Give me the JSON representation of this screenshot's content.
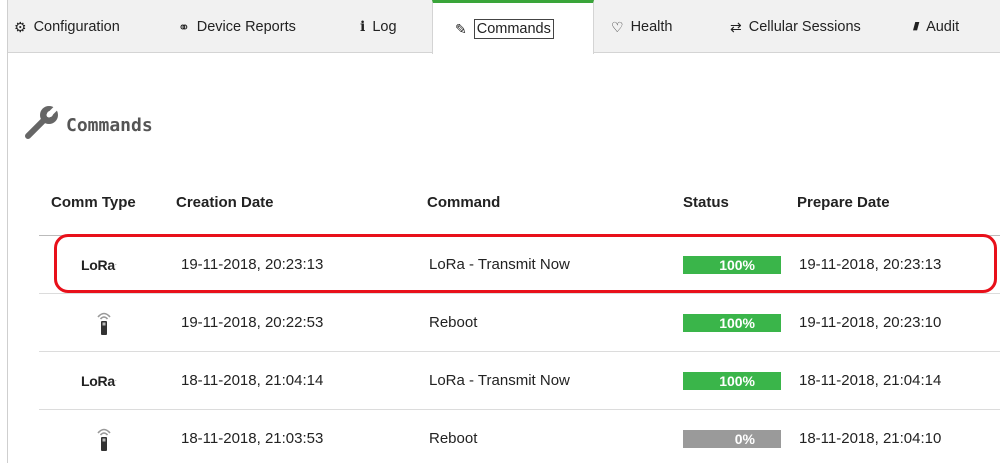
{
  "tabs": [
    {
      "label": "Configuration",
      "icon": "gears-icon",
      "glyph": "⚙"
    },
    {
      "label": "Device Reports",
      "icon": "share-nodes-icon",
      "glyph": "⚭"
    },
    {
      "label": "Log",
      "icon": "info-icon",
      "glyph": "i"
    },
    {
      "label": "Commands",
      "icon": "wrench-icon",
      "glyph": "✎"
    },
    {
      "label": "Health",
      "icon": "stethoscope-icon",
      "glyph": "♡"
    },
    {
      "label": "Cellular Sessions",
      "icon": "exchange-icon",
      "glyph": "⇄"
    },
    {
      "label": "Audit",
      "icon": "book-icon",
      "glyph": "▮"
    }
  ],
  "active_tab": "Commands",
  "section_title": "Commands",
  "table": {
    "columns": [
      "Comm Type",
      "Creation Date",
      "Command",
      "Status",
      "Prepare Date"
    ],
    "rows": [
      {
        "comm_type": "LoRa",
        "creation_date": "19-11-2018, 20:23:13",
        "command": "LoRa - Transmit Now",
        "status": "100%",
        "status_color": "#3ab54a",
        "prepare_date": "19-11-2018, 20:23:13"
      },
      {
        "comm_type": "cellular",
        "creation_date": "19-11-2018, 20:22:53",
        "command": "Reboot",
        "status": "100%",
        "status_color": "#3ab54a",
        "prepare_date": "19-11-2018, 20:23:10"
      },
      {
        "comm_type": "LoRa",
        "creation_date": "18-11-2018, 21:04:14",
        "command": "LoRa - Transmit Now",
        "status": "100%",
        "status_color": "#3ab54a",
        "prepare_date": "18-11-2018, 21:04:14"
      },
      {
        "comm_type": "cellular",
        "creation_date": "18-11-2018, 21:03:53",
        "command": "Reboot",
        "status": "0%",
        "status_color": "#9a9a9a",
        "prepare_date": "18-11-2018, 21:04:10"
      }
    ]
  },
  "colors": {
    "accent": "#3aa53a",
    "highlight": "#e8101a"
  }
}
